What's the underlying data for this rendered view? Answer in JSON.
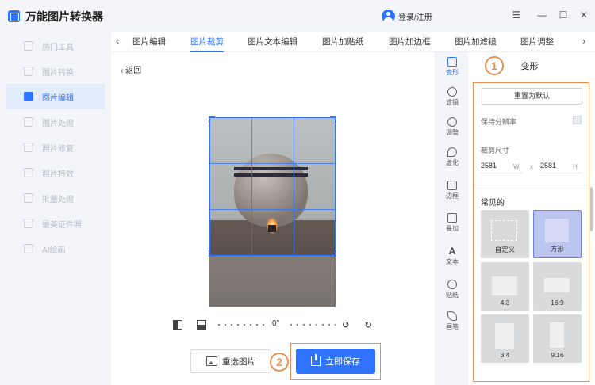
{
  "app": {
    "title": "万能图片转换器",
    "login": "登录/注册"
  },
  "window_controls": {
    "menu": "☰",
    "minimize": "—",
    "maximize": "☐",
    "close": "✕"
  },
  "sidebar": {
    "items": [
      {
        "label": "热门工具",
        "icon": "hot-tools-icon"
      },
      {
        "label": "图片转换",
        "icon": "image-convert-icon"
      },
      {
        "label": "图片编辑",
        "icon": "image-edit-icon",
        "active": true
      },
      {
        "label": "图片处理",
        "icon": "image-process-icon"
      },
      {
        "label": "照片修复",
        "icon": "photo-repair-icon"
      },
      {
        "label": "照片特效",
        "icon": "photo-effects-icon"
      },
      {
        "label": "批量处理",
        "icon": "batch-icon"
      },
      {
        "label": "最美证件照",
        "icon": "id-photo-icon"
      },
      {
        "label": "AI绘画",
        "icon": "ai-paint-icon"
      }
    ]
  },
  "tabs": {
    "prev": "‹",
    "next": "›",
    "items": [
      "图片编辑",
      "图片裁剪",
      "图片文本编辑",
      "图片加贴纸",
      "图片加边框",
      "图片加滤镜",
      "图片调整"
    ],
    "active_index": 1
  },
  "editor": {
    "back": "‹  返回",
    "rotate_angle": "0°",
    "rotate_left": "↺",
    "rotate_right": "↻",
    "reselect_button": "重选图片",
    "save_button": "立即保存",
    "marker_2": "2"
  },
  "tools": {
    "items": [
      {
        "label": "变形",
        "icon": "crop-icon",
        "active": true
      },
      {
        "label": "滤镜",
        "icon": "filter-icon"
      },
      {
        "label": "调整",
        "icon": "adjust-icon"
      },
      {
        "label": "虚化",
        "icon": "blur-icon"
      },
      {
        "label": "边框",
        "icon": "border-icon"
      },
      {
        "label": "叠加",
        "icon": "overlay-icon"
      },
      {
        "label": "文本",
        "icon": "text-icon"
      },
      {
        "label": "贴纸",
        "icon": "sticker-icon"
      },
      {
        "label": "画笔",
        "icon": "brush-icon"
      }
    ]
  },
  "panel": {
    "title": "变形",
    "marker_1": "1",
    "reset_button": "重置为默认",
    "keep_resolution_label": "保持分辨率",
    "crop_size_label": "裁剪尺寸",
    "width_value": "2581",
    "width_unit": "W",
    "times": "x",
    "height_value": "2581",
    "height_unit": "H",
    "common_label": "常见的",
    "presets": [
      {
        "label": "自定义"
      },
      {
        "label": "方形",
        "active": true
      },
      {
        "label": "4:3"
      },
      {
        "label": "16:9"
      },
      {
        "label": "3:4"
      },
      {
        "label": "9:16"
      }
    ]
  },
  "colors": {
    "accent": "#2f73ff",
    "highlight": "#ec8f52"
  }
}
